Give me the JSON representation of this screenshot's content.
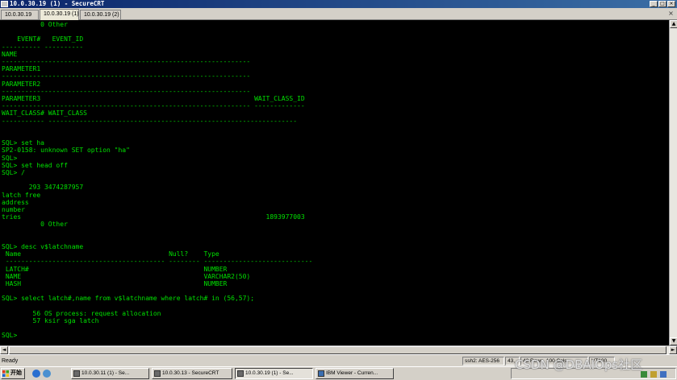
{
  "window": {
    "title": "10.0.30.19  (1) - SecureCRT"
  },
  "tabs": [
    {
      "label": "10.0.30.19"
    },
    {
      "label": "10.0.30.19 (1)"
    },
    {
      "label": "10.0.30.19 (2)"
    }
  ],
  "terminal": {
    "lines": [
      "          0 Other",
      "",
      "    EVENT#   EVENT_ID",
      "---------- ----------",
      "NAME",
      "----------------------------------------------------------------",
      "PARAMETER1",
      "----------------------------------------------------------------",
      "PARAMETER2",
      "----------------------------------------------------------------",
      "PARAMETER3                                                       WAIT_CLASS_ID",
      "---------------------------------------------------------------- -------------",
      "WAIT_CLASS# WAIT_CLASS",
      "----------- ----------------------------------------------------------------",
      "",
      "",
      "SQL> set ha",
      "SP2-0158: unknown SET option \"ha\"",
      "SQL>",
      "SQL> set head off",
      "SQL> /",
      "",
      "       293 3474287957",
      "latch free",
      "address",
      "number",
      "tries                                                               1893977003",
      "          0 Other",
      "",
      "",
      "SQL> desc v$latchname",
      " Name                                      Null?    Type",
      " ----------------------------------------- -------- ----------------------------",
      " LATCH#                                             NUMBER",
      " NAME                                               VARCHAR2(50)",
      " HASH                                               NUMBER",
      "",
      "SQL> select latch#,name from v$latchname where latch# in (56,57);",
      "",
      "        56 OS process: request allocation",
      "        57 ksir sga latch",
      "",
      "SQL>"
    ]
  },
  "status": {
    "text": "Ready",
    "protocol": "ssh2: AES-256",
    "position": "43,",
    "size": "43 Rows, 100 Cols",
    "term": "VT100"
  },
  "taskbar": {
    "start_label": "开始",
    "tasks": [
      {
        "label": "10.0.30.11 (1) - Se..."
      },
      {
        "label": "10.0.30.13 - SecureCRT"
      },
      {
        "label": "10.0.30.19 (1) - Se..."
      },
      {
        "label": "IBM Viewer - Curren..."
      }
    ]
  },
  "watermark": "CSDN @DBAIOps社区",
  "colors": {
    "terminal_bg": "#000000",
    "terminal_fg": "#00e000",
    "titlebar": "#0a246a"
  }
}
